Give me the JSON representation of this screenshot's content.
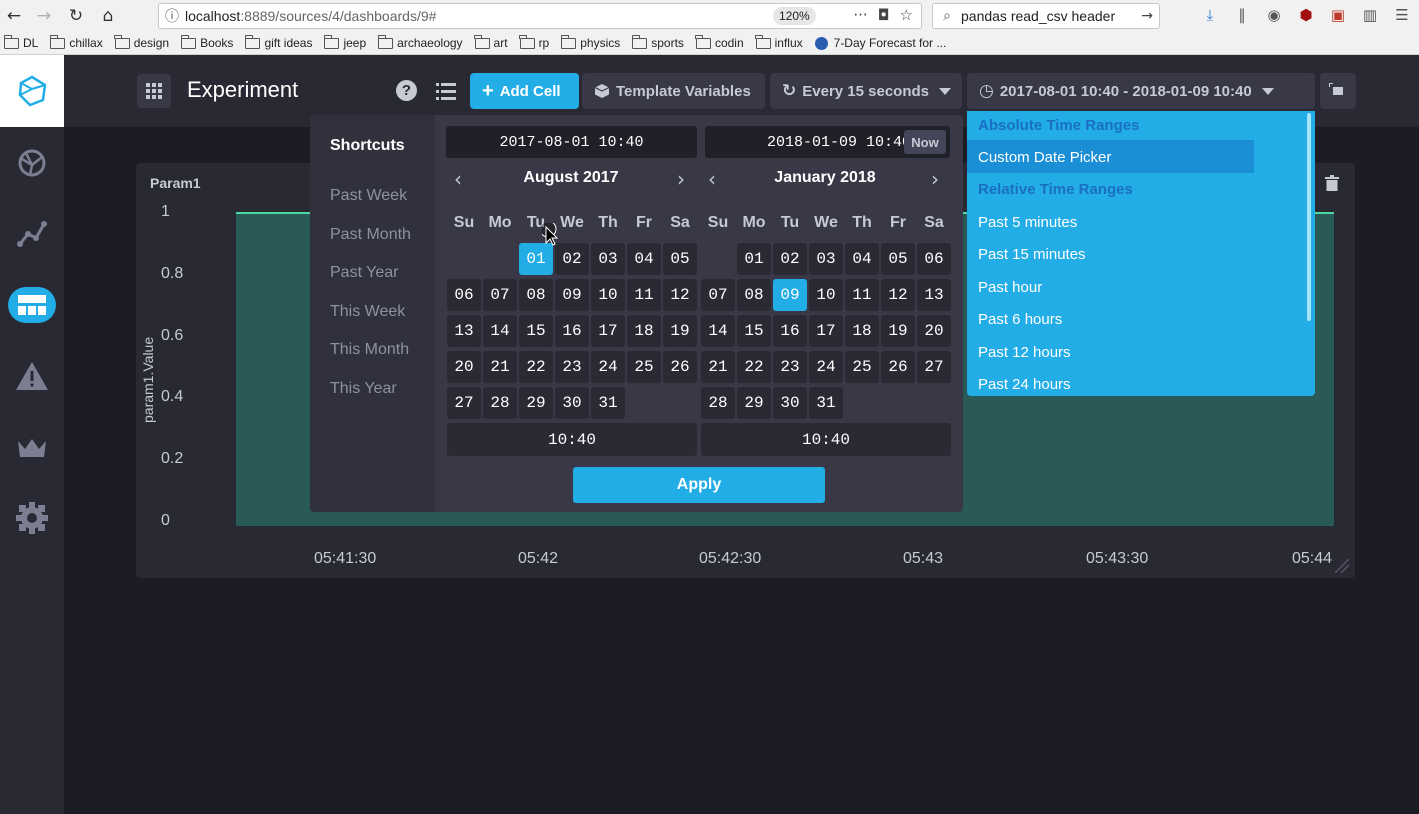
{
  "browser": {
    "url_host": "localhost",
    "url_path": ":8889/sources/4/dashboards/9#",
    "zoom": "120%",
    "search_text": "pandas read_csv header",
    "bookmarks": [
      "DL",
      "chillax",
      "design",
      "Books",
      "gift ideas",
      "jeep",
      "archaeology",
      "art",
      "rp",
      "physics",
      "sports",
      "codin",
      "influx"
    ],
    "bookmark_special": "7-Day Forecast for ..."
  },
  "header": {
    "title": "Experiment",
    "add_cell": "Add Cell",
    "template_variables": "Template Variables",
    "refresh": "Every 15 seconds",
    "time_range": "2017-08-01 10:40 - 2018-01-09 10:40"
  },
  "cell": {
    "title": "Param1",
    "ylabel": "param1.Value",
    "yticks": [
      "1",
      "0.8",
      "0.6",
      "0.4",
      "0.2",
      "0"
    ],
    "xticks": [
      "05:41:30",
      "05:42",
      "05:42:30",
      "05:43",
      "05:43:30",
      "05:44"
    ]
  },
  "chart_data": {
    "type": "area",
    "title": "Param1",
    "xlabel": "",
    "ylabel": "param1.Value",
    "x": [
      "05:41:30",
      "05:42",
      "05:42:30",
      "05:43",
      "05:43:30",
      "05:44"
    ],
    "series": [
      {
        "values": [
          1,
          1,
          1,
          1,
          1,
          1
        ]
      }
    ],
    "ylim": [
      0,
      1
    ],
    "color": "#4ed8a0"
  },
  "picker": {
    "shortcuts_title": "Shortcuts",
    "shortcuts": [
      "Past Week",
      "Past Month",
      "Past Year",
      "This Week",
      "This Month",
      "This Year"
    ],
    "start_input": "2017-08-01 10:40",
    "end_input": "2018-01-09 10:40",
    "now": "Now",
    "left_month": "August 2017",
    "right_month": "January 2018",
    "dow": [
      "Su",
      "Mo",
      "Tu",
      "We",
      "Th",
      "Fr",
      "Sa"
    ],
    "left_start_col": 2,
    "left_days": 31,
    "left_selected": "01",
    "right_start_col": 1,
    "right_days": 31,
    "right_selected": "09",
    "left_time": "10:40",
    "right_time": "10:40",
    "apply": "Apply"
  },
  "dropdown": {
    "absolute_header": "Absolute Time Ranges",
    "custom": "Custom Date Picker",
    "relative_header": "Relative Time Ranges",
    "items": [
      "Past 5 minutes",
      "Past 15 minutes",
      "Past hour",
      "Past 6 hours",
      "Past 12 hours",
      "Past 24 hours"
    ]
  },
  "colors": {
    "accent": "#22ade6",
    "header_text": "#1a6fc4"
  }
}
